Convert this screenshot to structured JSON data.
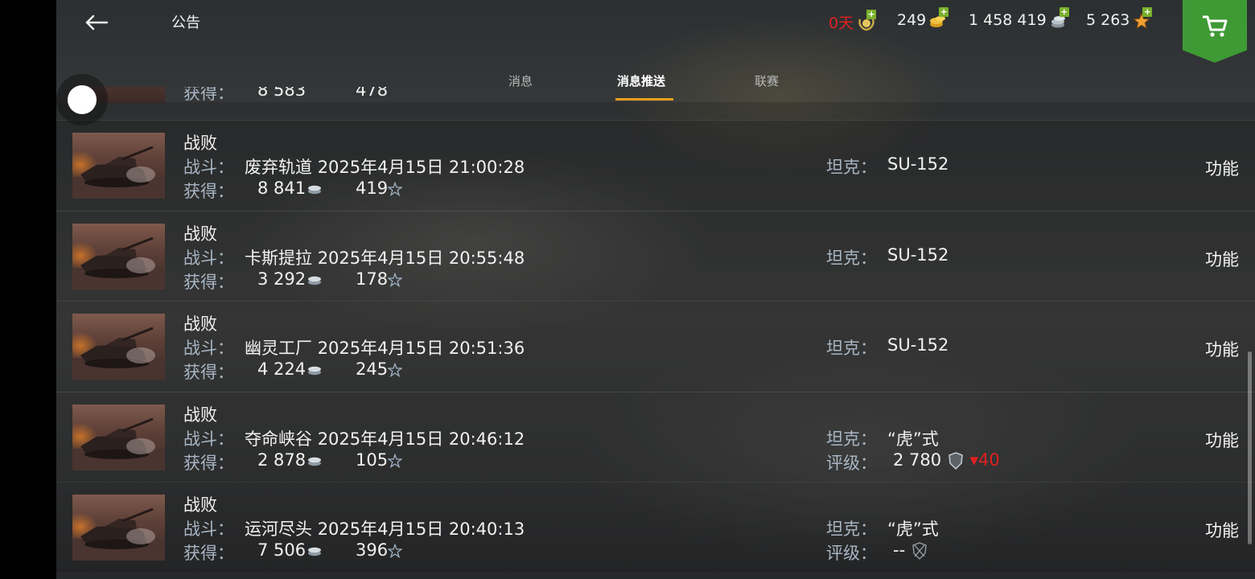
{
  "header": {
    "title": "公告",
    "currencies": {
      "premium_days": "0天",
      "gold": "249",
      "silver": "1 458 419",
      "free_xp": "5 263"
    }
  },
  "tabs": [
    {
      "label": "消息",
      "active": false
    },
    {
      "label": "消息推送",
      "active": true
    },
    {
      "label": "联赛",
      "active": false
    }
  ],
  "labels": {
    "battle": "战斗：",
    "earned": "获得：",
    "tank": "坦克：",
    "rating": "评级：",
    "function": "功能"
  },
  "partial_row": {
    "silver": "8 583",
    "xp": "478"
  },
  "messages": [
    {
      "result": "战败",
      "map": "废弃轨道",
      "datetime": "2025年4月15日 21:00:28",
      "silver": "8 841",
      "xp": "419",
      "tank": "SU-152"
    },
    {
      "result": "战败",
      "map": "卡斯提拉",
      "datetime": "2025年4月15日 20:55:48",
      "silver": "3 292",
      "xp": "178",
      "tank": "SU-152"
    },
    {
      "result": "战败",
      "map": "幽灵工厂",
      "datetime": "2025年4月15日 20:51:36",
      "silver": "4 224",
      "xp": "245",
      "tank": "SU-152"
    },
    {
      "result": "战败",
      "map": "夺命峡谷",
      "datetime": "2025年4月15日 20:46:12",
      "silver": "2 878",
      "xp": "105",
      "tank": "“虎”式",
      "rating": "2 780",
      "rating_change": "▾40"
    },
    {
      "result": "战败",
      "map": "运河尽头",
      "datetime": "2025年4月15日 20:40:13",
      "silver": "7 506",
      "xp": "396",
      "tank": "“虎”式",
      "rating": "--"
    }
  ],
  "colors": {
    "accent_tab": "#f0a020",
    "shop": "#3e9a34",
    "premium_red": "#e02020",
    "label": "#a8b6c4"
  }
}
